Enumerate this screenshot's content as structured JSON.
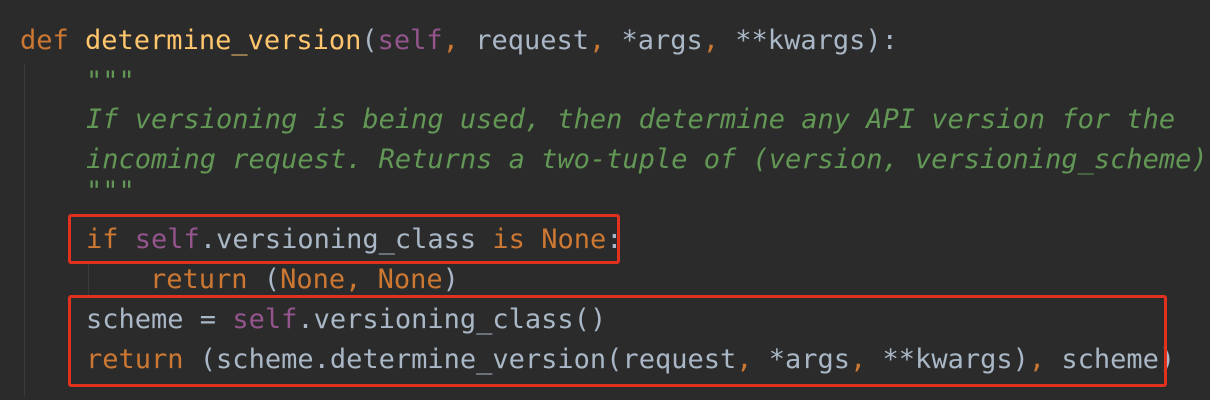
{
  "code": {
    "line1": {
      "kw_def": "def ",
      "func_name": "determine_version",
      "open_paren": "(",
      "self": "self",
      "sep1": ", ",
      "arg_request": "request",
      "sep2": ", ",
      "arg_args": "*args",
      "sep3": ", ",
      "arg_kwargs": "**kwargs",
      "close": "):"
    },
    "doc_open": "\"\"\"",
    "doc_line1": "If versioning is being used, then determine any API version for the",
    "doc_line2": "incoming request. Returns a two-tuple of (version, versioning_scheme)",
    "doc_close": "\"\"\"",
    "if_line": {
      "kw_if": "if ",
      "self": "self",
      "attr": ".versioning_class ",
      "kw_is": "is ",
      "kw_none": "None",
      "colon": ":"
    },
    "return1": {
      "kw_return": "return ",
      "open": "(",
      "none1": "None",
      "comma": ", ",
      "none2": "None",
      "close": ")"
    },
    "scheme_line": {
      "var": "scheme = ",
      "self": "self",
      "rest": ".versioning_class()"
    },
    "return2": {
      "kw_return": "return ",
      "part1": "(scheme.determine_version(request",
      "comma1": ", ",
      "args": "*args",
      "comma2": ", ",
      "kwargs": "**kwargs)",
      "comma3": ", ",
      "scheme": "scheme)"
    }
  },
  "colors": {
    "background": "#2b2b2b",
    "keyword": "#cc7832",
    "function": "#ffc66d",
    "self": "#94558d",
    "text": "#a9b7c6",
    "docstring": "#629755",
    "highlight": "#e0321e"
  }
}
